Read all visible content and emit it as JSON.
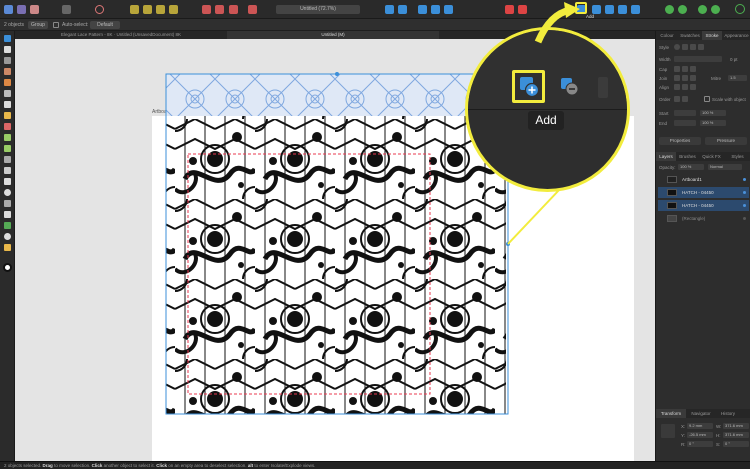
{
  "app": {
    "document_title": "Untitled (72.7%)",
    "canvas_tab_active": "Untitled (M)",
    "canvas_tab_inactive": "Elegant Lace Pattern - 8K · Untitled (UnsavedDocument) 8K",
    "artboard_label": "Artboard1"
  },
  "context_toolbar": {
    "selection_count": "2 objects",
    "group_button": "Group",
    "auto_select_label": "Auto-select:",
    "auto_select_value": "Default"
  },
  "zoom_callout": {
    "tooltip_label": "Add",
    "small_tooltip_label": "Add"
  },
  "right_panel": {
    "top_tabs": [
      "Colour",
      "Swatches",
      "Stroke",
      "Appearance"
    ],
    "active_top_tab": "Stroke",
    "style_label": "Style",
    "width_label": "Width",
    "width_value": "0 pt",
    "cap_label": "Cap",
    "join_label": "Join",
    "mitre_label": "Mitre",
    "mitre_value": "1.5",
    "align_label": "Align",
    "order_label": "Order",
    "scale_with_object_label": "Scale with object",
    "start_label": "Start",
    "end_label": "End",
    "start_value": "100 %",
    "end_value": "100 %",
    "properties_button": "Properties",
    "pressure_button": "Pressure",
    "layer_tabs": [
      "Layers",
      "Brushes",
      "Quick FX",
      "Styles"
    ],
    "active_layer_tab": "Layers",
    "opacity_label": "Opacity:",
    "opacity_value": "100 %",
    "blend_mode": "Normal",
    "layers": [
      {
        "name": "Artboard1",
        "selected": false
      },
      {
        "name": "HATCH - 04450",
        "selected": true
      },
      {
        "name": "HATCH - 04450",
        "selected": true
      },
      {
        "name": "(Rectangle)",
        "selected": false
      }
    ],
    "bottom_tabs": [
      "Transform",
      "Navigator",
      "History"
    ],
    "active_bottom_tab": "Transform",
    "transform": {
      "x_label": "X:",
      "x_value": "9.2 mm",
      "y_label": "Y:",
      "y_value": "-26.5 mm",
      "w_label": "W:",
      "w_value": "371.6 mm",
      "h_label": "H:",
      "h_value": "371.6 mm",
      "r_label": "R:",
      "r_value": "0 °",
      "s_label": "S:",
      "s_value": "0 °"
    }
  },
  "status_bar": {
    "prefix": "2 objects selected.",
    "drag": "Drag",
    "drag_text": "to move selection.",
    "click": "Click",
    "click_text": "another object to select it.",
    "click2": "Click",
    "click2_text": "on an empty area to deselect selection.",
    "alt": "alt",
    "alt_text": "to enter Isolate/Explode views."
  },
  "colors": {
    "highlight": "#f2ec3d",
    "accent_blue": "#3b8fd9",
    "lace": "#111111",
    "lace_ghost": "#7fa8e0",
    "crop_red": "#e8384f"
  }
}
